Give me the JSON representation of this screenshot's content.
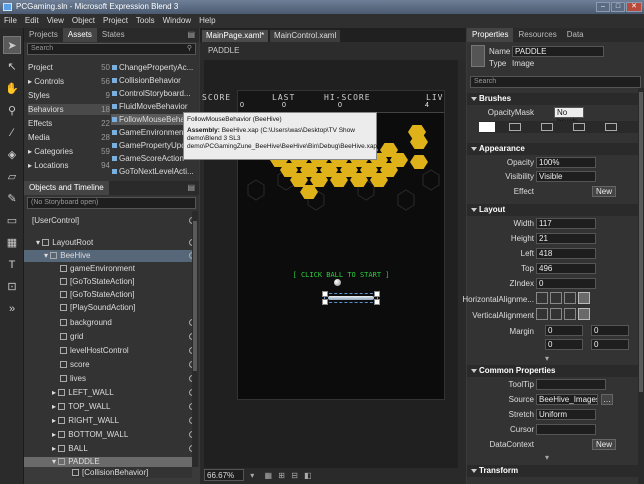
{
  "window": {
    "title": "PCGaming.sln - Microsoft Expression Blend 3",
    "min": "–",
    "max": "□",
    "close": "✕"
  },
  "menu": [
    "File",
    "Edit",
    "View",
    "Object",
    "Project",
    "Tools",
    "Window",
    "Help"
  ],
  "left_tabs": [
    "Projects",
    "Assets",
    "States"
  ],
  "search_placeholder": "Search",
  "categories": [
    {
      "label": "Project",
      "count": "50"
    },
    {
      "label": "Controls",
      "count": "56"
    },
    {
      "label": "Styles",
      "count": "9"
    },
    {
      "label": "Behaviors",
      "count": "18"
    },
    {
      "label": "Effects",
      "count": "22"
    },
    {
      "label": "Media",
      "count": "28"
    },
    {
      "label": "Categories",
      "count": "59"
    },
    {
      "label": "Locations",
      "count": "94"
    }
  ],
  "assets": [
    "ChangePropertyAc...",
    "CollisionBehavior",
    "ControlStoryboard...",
    "FluidMoveBehavior",
    "FollowMouseBehavior",
    "GameEnvironment",
    "GamePropertyUpd...",
    "GameScoreAction",
    "GoToNextLevelActi..."
  ],
  "tooltip": {
    "title": "FollowMouseBehavior (BeeHive)",
    "label": "Assembly:",
    "assembly": "BeeHive.xap (C:\\Users\\was\\Desktop\\TV Show demo\\Blend 3 SL3 demo\\PCGamingZune_BeeHive\\BeeHive\\Bin\\Debug\\BeeHive.xap)"
  },
  "objects": {
    "header": "Objects and Timeline",
    "storyboard": "(No Storyboard open)",
    "nodes": [
      "[UserControl]",
      "LayoutRoot",
      "BeeHive",
      "gameEnvironment",
      "[GoToStateAction]",
      "[GoToStateAction]",
      "[PlaySoundAction]",
      "background",
      "grid",
      "levelHostControl",
      "score",
      "lives",
      "LEFT_WALL",
      "TOP_WALL",
      "RIGHT_WALL",
      "BOTTOM_WALL",
      "BALL",
      "PADDLE",
      "[CollisionBehavior]"
    ]
  },
  "doc_tabs": [
    "MainPage.xaml*",
    "MainControl.xaml"
  ],
  "breadcrumb": "PADDLE",
  "game": {
    "hud_labels": [
      "SCORE",
      "LAST",
      "HI-SCORE",
      "LIVES"
    ],
    "hud_values": [
      "0",
      "0",
      "0",
      "4"
    ],
    "prompt": "[ CLICK BALL TO START ]"
  },
  "zoom": "66.67%",
  "right_tabs": [
    "Properties",
    "Resources",
    "Data"
  ],
  "props": {
    "name_label": "Name",
    "name": "PADDLE",
    "type_label": "Type",
    "type": "Image",
    "search": "Search",
    "brushes": "Brushes",
    "opacity_mask": "OpacityMask",
    "no_brush": "No brush",
    "appearance": "Appearance",
    "opacity_label": "Opacity",
    "opacity": "100%",
    "visibility_label": "Visibility",
    "visibility": "Visible",
    "effect_label": "Effect",
    "new": "New",
    "layout": "Layout",
    "width_label": "Width",
    "width": "117",
    "height_label": "Height",
    "height": "21",
    "left_label": "Left",
    "left": "418",
    "top_label": "Top",
    "top": "496",
    "zindex_label": "ZIndex",
    "zindex": "0",
    "halign": "HorizontalAlignme...",
    "valign": "VerticalAlignment",
    "margin": "Margin",
    "margin_vals": [
      "0",
      "0",
      "0",
      "0"
    ],
    "common": "Common Properties",
    "tooltip_label": "ToolTip",
    "source_label": "Source",
    "source": "BeeHive_Images/(...",
    "stretch_label": "Stretch",
    "stretch": "Uniform",
    "cursor_label": "Cursor",
    "datacontext_label": "DataContext",
    "datacontext_new": "New",
    "transform": "Transform"
  },
  "colors": {
    "hex": "#e0b21a",
    "prompt": "#2ecc40",
    "paddle": "#b8c8d8"
  }
}
